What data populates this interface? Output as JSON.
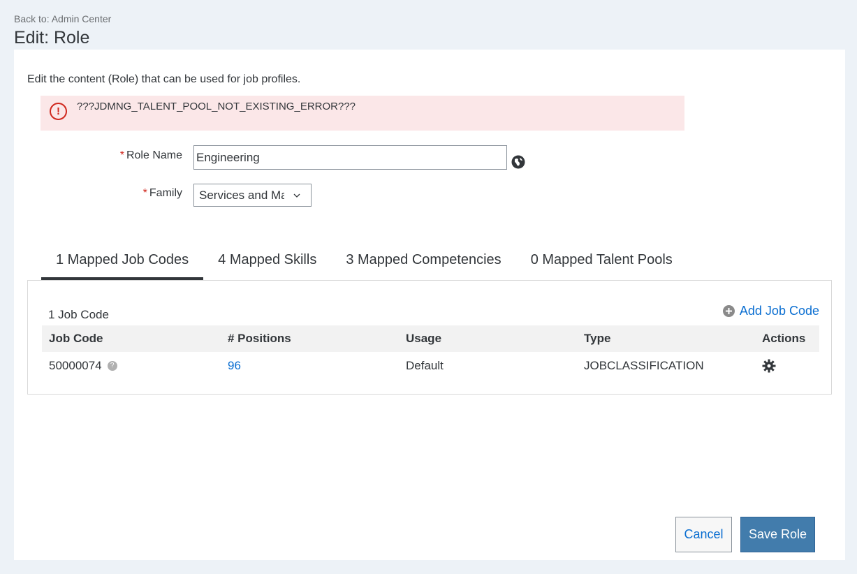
{
  "header": {
    "back_link": "Back to: Admin Center",
    "title": "Edit: Role"
  },
  "content": {
    "description": "Edit the content (Role) that can be used for job profiles.",
    "error_message": "???JDMNG_TALENT_POOL_NOT_EXISTING_ERROR???",
    "error_icon": "!"
  },
  "form": {
    "required_marker": "*",
    "role_name_label": "Role Name",
    "role_name_value": "Engineering",
    "family_label": "Family",
    "family_value": "Services and Maintenance"
  },
  "tabs": [
    {
      "label": "1 Mapped Job Codes",
      "active": true
    },
    {
      "label": "4 Mapped Skills",
      "active": false
    },
    {
      "label": "3 Mapped Competencies",
      "active": false
    },
    {
      "label": "0 Mapped Talent Pools",
      "active": false
    }
  ],
  "job_codes": {
    "count_label": "1 Job Code",
    "add_label": "Add Job Code",
    "columns": [
      "Job Code",
      "# Positions",
      "Usage",
      "Type",
      "Actions"
    ],
    "rows": [
      {
        "job_code": "50000074",
        "positions": "96",
        "usage": "Default",
        "type": "JOBCLASSIFICATION"
      }
    ],
    "help_glyph": "?"
  },
  "footer": {
    "cancel_label": "Cancel",
    "save_label": "Save Role"
  },
  "icons": [
    "error-icon",
    "globe-icon",
    "chevron-down-icon",
    "plus-circle-icon",
    "help-icon",
    "gear-icon"
  ],
  "colors": {
    "page_bg": "#edf2f7",
    "error_bg": "#fbe7e8",
    "error_red": "#d0271d",
    "link_blue": "#0a6ed1",
    "primary_button": "#427cac"
  }
}
